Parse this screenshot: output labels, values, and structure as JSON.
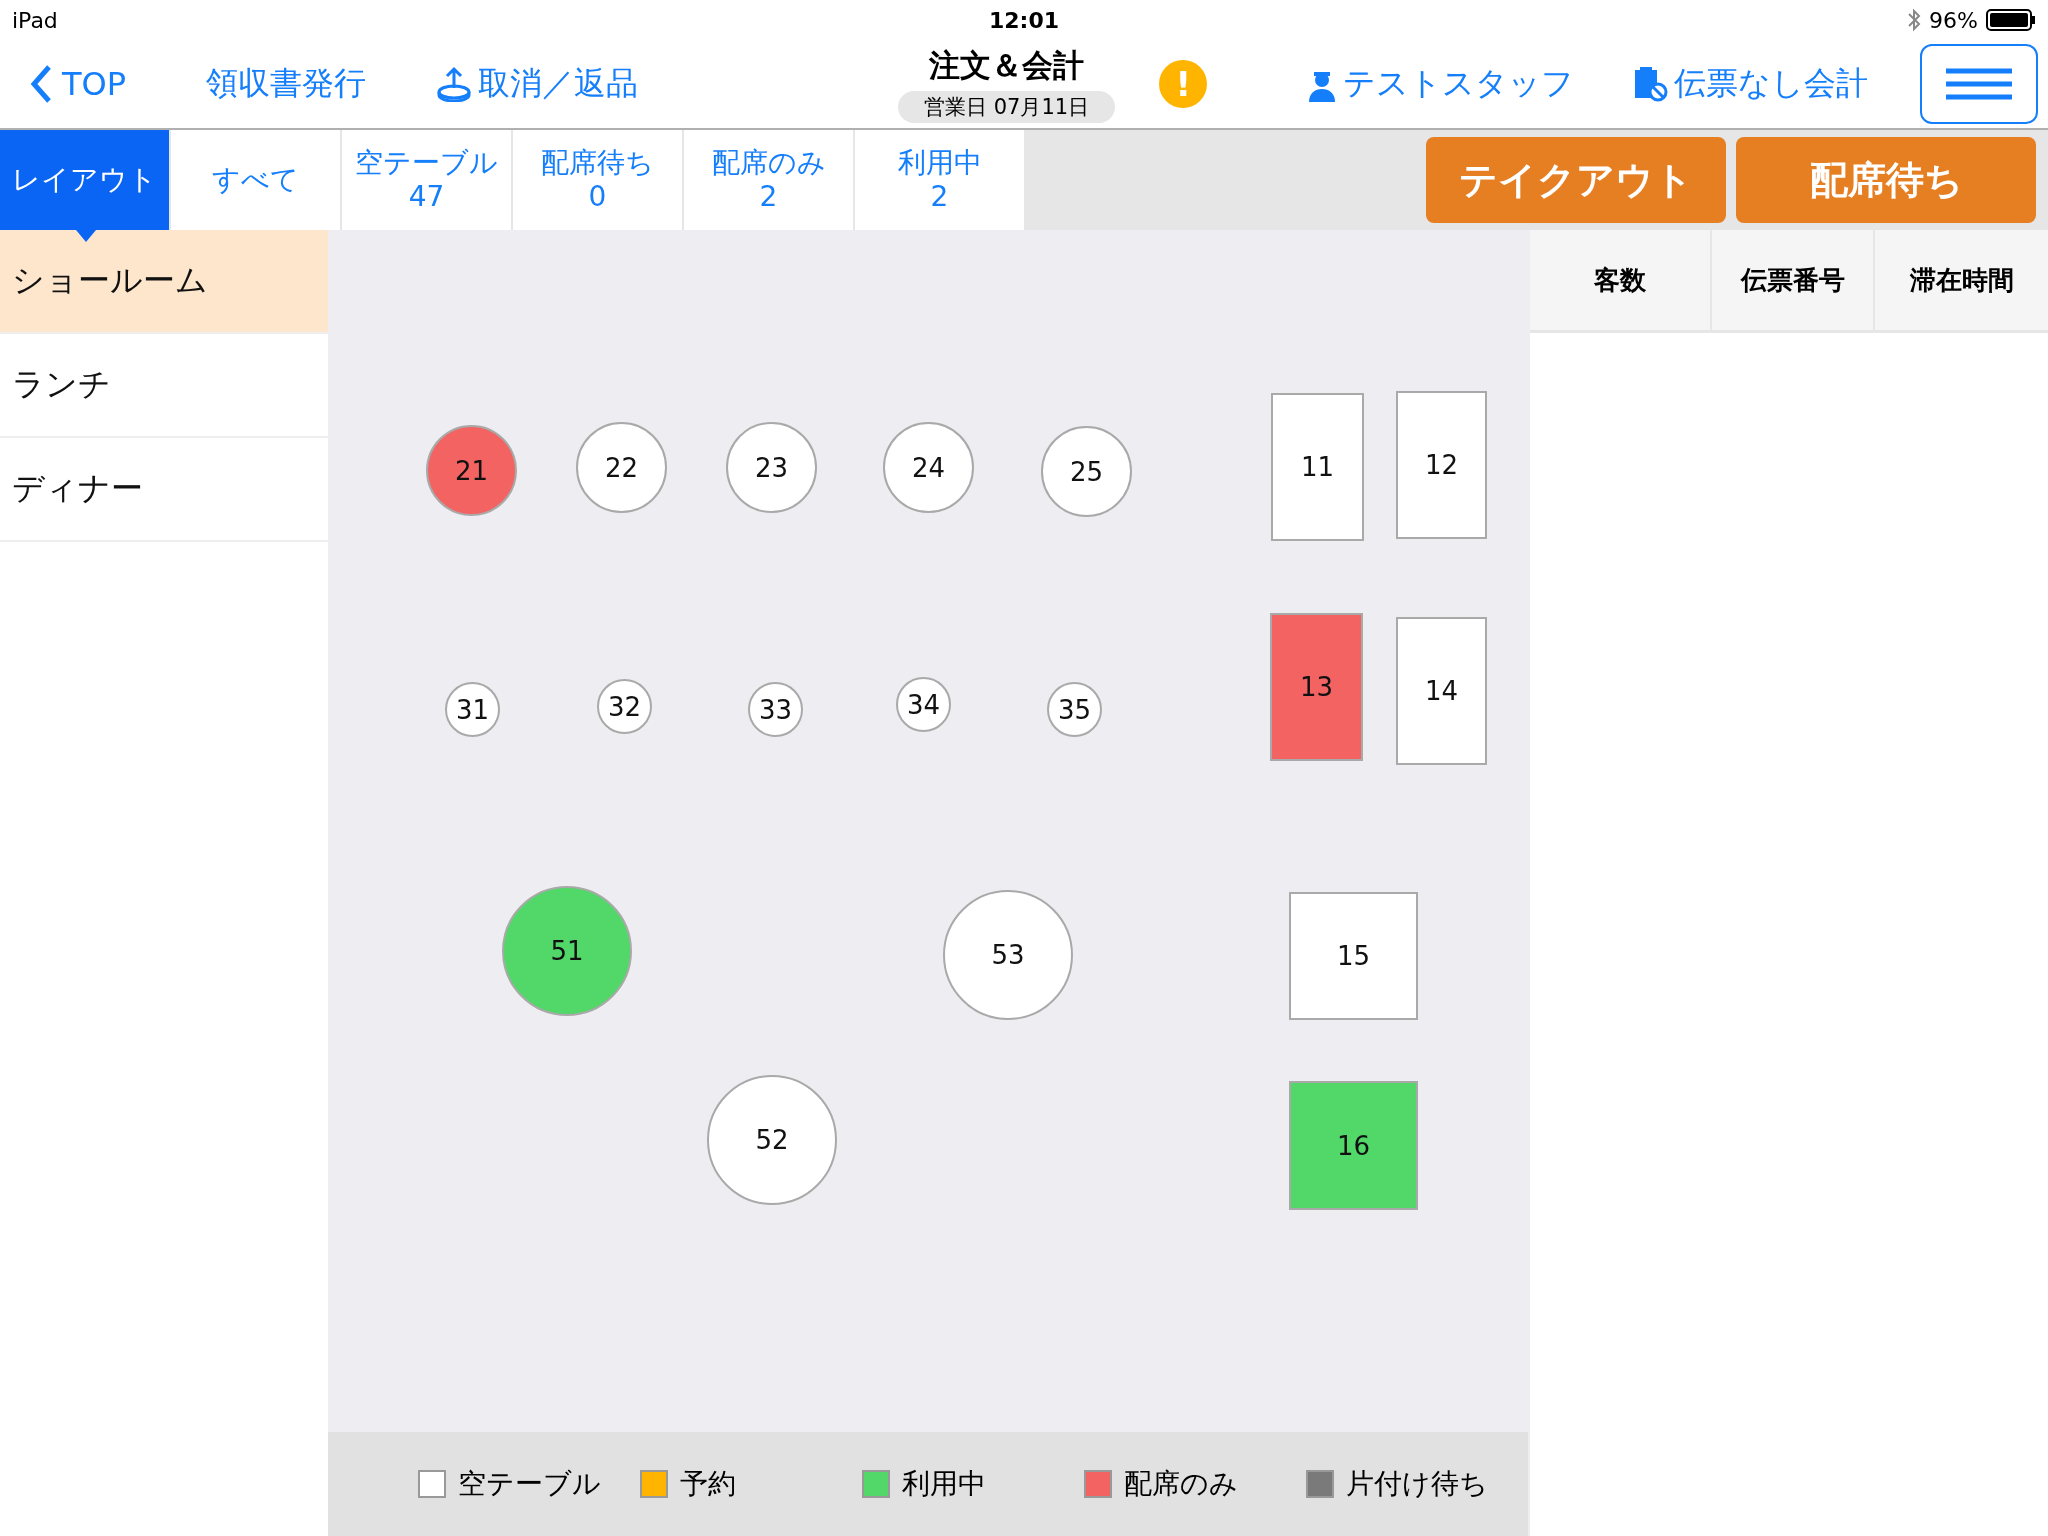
{
  "status_bar": {
    "device": "iPad",
    "time": "12:01",
    "battery": "96%"
  },
  "nav": {
    "back": "TOP",
    "receipt": "領収書発行",
    "cancel": "取消／返品",
    "title": "注文＆会計",
    "business_date": "営業日 07月11日",
    "alert": "!",
    "staff": "テストスタッフ",
    "no_slip": "伝票なし会計"
  },
  "tabs": [
    {
      "label": "レイアウト",
      "selected": true
    },
    {
      "label": "すべて",
      "selected": false
    },
    {
      "label": "空テーブル",
      "count": "47",
      "selected": false
    },
    {
      "label": "配席待ち",
      "count": "0",
      "selected": false
    },
    {
      "label": "配席のみ",
      "count": "2",
      "selected": false
    },
    {
      "label": "利用中",
      "count": "2",
      "selected": false
    }
  ],
  "actions": [
    "テイクアウト",
    "配席待ち"
  ],
  "sidebar": {
    "items": [
      {
        "label": "ショールーム",
        "selected": true
      },
      {
        "label": "ランチ",
        "selected": false
      },
      {
        "label": "ディナー",
        "selected": false
      }
    ]
  },
  "tables": [
    {
      "label": "21",
      "kind": "circle",
      "color": "#f26361"
    },
    {
      "label": "22",
      "kind": "circle",
      "color": "#ffffff"
    },
    {
      "label": "23",
      "kind": "circle",
      "color": "#ffffff"
    },
    {
      "label": "24",
      "kind": "circle",
      "color": "#ffffff"
    },
    {
      "label": "25",
      "kind": "circle",
      "color": "#ffffff"
    },
    {
      "label": "31",
      "kind": "circle",
      "color": "#ffffff"
    },
    {
      "label": "32",
      "kind": "circle",
      "color": "#ffffff"
    },
    {
      "label": "33",
      "kind": "circle",
      "color": "#ffffff"
    },
    {
      "label": "34",
      "kind": "circle",
      "color": "#ffffff"
    },
    {
      "label": "35",
      "kind": "circle",
      "color": "#ffffff"
    },
    {
      "label": "51",
      "kind": "circle",
      "color": "#52d769"
    },
    {
      "label": "53",
      "kind": "circle",
      "color": "#ffffff"
    },
    {
      "label": "52",
      "kind": "circle",
      "color": "#ffffff"
    },
    {
      "label": "11",
      "kind": "rect",
      "color": "#ffffff"
    },
    {
      "label": "12",
      "kind": "rect",
      "color": "#ffffff"
    },
    {
      "label": "13",
      "kind": "rect",
      "color": "#f26361"
    },
    {
      "label": "14",
      "kind": "rect",
      "color": "#ffffff"
    },
    {
      "label": "15",
      "kind": "rect",
      "color": "#ffffff"
    },
    {
      "label": "16",
      "kind": "rect",
      "color": "#52d769"
    }
  ],
  "legend": [
    {
      "label": "空テーブル",
      "color": "#ffffff"
    },
    {
      "label": "予約",
      "color": "#ffb400"
    },
    {
      "label": "利用中",
      "color": "#52d769"
    },
    {
      "label": "配席のみ",
      "color": "#f26361"
    },
    {
      "label": "片付け待ち",
      "color": "#7a7a7a"
    }
  ],
  "table": {
    "columns": [
      "客数",
      "伝票番号",
      "滞在時間"
    ]
  }
}
